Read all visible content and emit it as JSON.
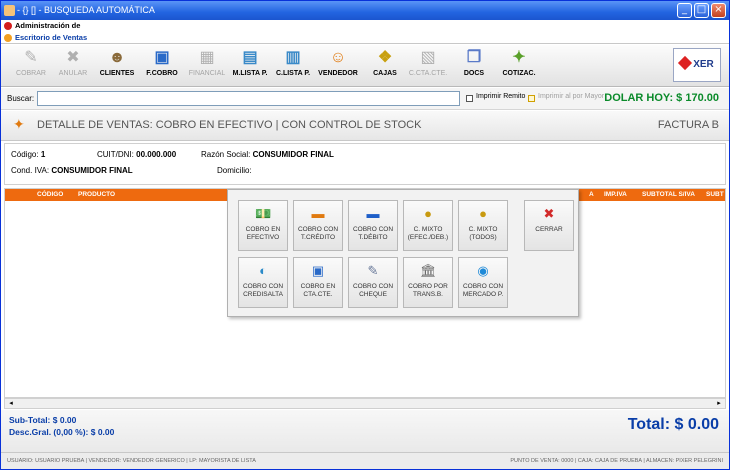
{
  "window": {
    "title": "- {} [] - BUSQUEDA AUTOMÁTICA"
  },
  "menu": {
    "admin": "Administración de",
    "escritorio": "Escritorio de Ventas"
  },
  "toolbar": [
    {
      "label": "COBRAR",
      "enabled": false,
      "icon": "cash-register-icon",
      "glyph": "✎"
    },
    {
      "label": "ANULAR",
      "enabled": false,
      "icon": "cancel-x-icon",
      "glyph": "✖"
    },
    {
      "label": "CLIENTES",
      "enabled": true,
      "icon": "clients-person-icon",
      "glyph": "☻"
    },
    {
      "label": "F.COBRO",
      "enabled": true,
      "icon": "payment-form-icon",
      "glyph": "▣"
    },
    {
      "label": "FINANCIAL",
      "enabled": false,
      "icon": "calculator-icon",
      "glyph": "▦"
    },
    {
      "label": "M.LISTA P.",
      "enabled": true,
      "icon": "price-list-icon",
      "glyph": "▤"
    },
    {
      "label": "C.LISTA P.",
      "enabled": true,
      "icon": "change-list-icon",
      "glyph": "▥"
    },
    {
      "label": "VENDEDOR",
      "enabled": true,
      "icon": "seller-person-icon",
      "glyph": "☺"
    },
    {
      "label": "CAJAS",
      "enabled": true,
      "icon": "cash-boxes-icon",
      "glyph": "❖"
    },
    {
      "label": "C.CTA.CTE.",
      "enabled": false,
      "icon": "account-icon",
      "glyph": "▧"
    },
    {
      "label": "DOCS",
      "enabled": true,
      "icon": "documents-icon",
      "glyph": "❐"
    },
    {
      "label": "COTIZAC.",
      "enabled": true,
      "icon": "quote-money-icon",
      "glyph": "✦"
    }
  ],
  "logo": {
    "text": "XER"
  },
  "search": {
    "label": "Buscar:",
    "value": "",
    "imprimir_remito": "Imprimir Remito",
    "imprimir_mayor": "Imprimir al por Mayor",
    "dolar": "DOLAR HOY: $ 170.00"
  },
  "header": {
    "title": "DETALLE DE VENTAS: COBRO EN EFECTIVO | CON CONTROL DE STOCK",
    "factura": "FACTURA B"
  },
  "client": {
    "codigo_label": "Código:",
    "codigo": "1",
    "cuit_label": "CUIT/DNI:",
    "cuit": "00.000.000",
    "razon_label": "Razón Social:",
    "razon": "CONSUMIDOR FINAL",
    "iva_label": "Cond. IVA:",
    "iva": "CONSUMIDOR FINAL",
    "domicilio_label": "Domicilio:",
    "domicilio": ""
  },
  "grid": {
    "columns": [
      "CÓDIGO",
      "PRODUCTO",
      "A",
      "IMP.IVA",
      "SUBTOTAL S/IVA",
      "SUBT"
    ]
  },
  "popup": [
    {
      "label1": "COBRO EN",
      "label2": "EFECTIVO",
      "icon": "cash-bills-icon",
      "glyph": "💵",
      "color": "#3a9a2a"
    },
    {
      "label1": "COBRO CON",
      "label2": "T.CRÉDITO",
      "icon": "credit-card-icon",
      "glyph": "▬",
      "color": "#e07a10"
    },
    {
      "label1": "COBRO CON",
      "label2": "T.DÉBITO",
      "icon": "debit-card-icon",
      "glyph": "▬",
      "color": "#1f5fc8"
    },
    {
      "label1": "C. MIXTO",
      "label2": "(EFEC./DEB.)",
      "icon": "money-bag-icon",
      "glyph": "●",
      "color": "#c89a10"
    },
    {
      "label1": "C. MIXTO",
      "label2": "(TODOS)",
      "icon": "money-bag-icon",
      "glyph": "●",
      "color": "#c89a10"
    },
    {
      "label1": "CERRAR",
      "label2": "",
      "icon": "close-red-icon",
      "glyph": "✖",
      "color": "#d22a2a"
    },
    {
      "label1": "COBRO CON",
      "label2": "CREDISALTA",
      "icon": "credisalta-icon",
      "glyph": "◐",
      "color": "#2a8ac8"
    },
    {
      "label1": "COBRO EN",
      "label2": "CTA.CTE.",
      "icon": "current-account-icon",
      "glyph": "▣",
      "color": "#2a6ac8"
    },
    {
      "label1": "COBRO CON",
      "label2": "CHEQUE",
      "icon": "check-pen-icon",
      "glyph": "✎",
      "color": "#6a7a9a"
    },
    {
      "label1": "COBRO POR",
      "label2": "TRANS.B.",
      "icon": "bank-icon",
      "glyph": "🏛",
      "color": "#6a6a6a"
    },
    {
      "label1": "COBRO CON",
      "label2": "MERCADO P.",
      "icon": "mercadopago-icon",
      "glyph": "◉",
      "color": "#1e8ad8"
    }
  ],
  "footer": {
    "subtotal": "Sub-Total: $ 0.00",
    "desc": "Desc.Gral. (0,00 %): $ 0.00",
    "total": "Total: $ 0.00"
  },
  "status": {
    "left": "USUARIO: USUARIO PRUEBA  |  VENDEDOR: VENDEDOR GENERICO  |  LP: MAYORISTA DE LISTA",
    "right": "PUNTO DE VENTA: 0000  |  CAJA: CAJA DE PRUEBA  |  ALMACEN: PIXER PELEGRINI"
  }
}
